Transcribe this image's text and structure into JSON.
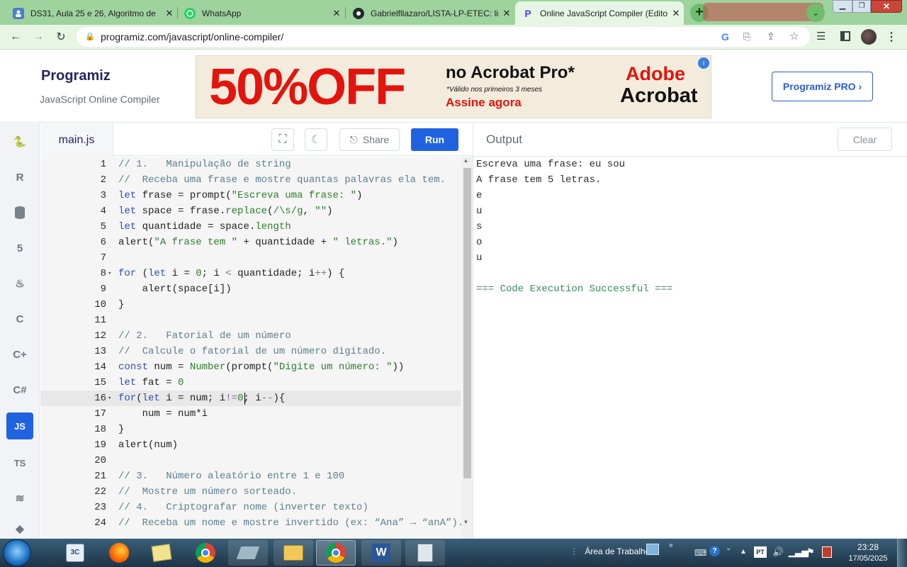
{
  "browser": {
    "tabs": [
      {
        "title": "DS31, Aula 25 e 26, Algoritmo de",
        "icon": "google-classroom-icon",
        "color": "#4a7dd6"
      },
      {
        "title": "WhatsApp",
        "icon": "whatsapp-icon",
        "color": "#25d366"
      },
      {
        "title": "Gabrielfllazaro/LISTA-LP-ETEC: lis",
        "icon": "github-icon",
        "color": "#24292e"
      },
      {
        "title": "Online JavaScript Compiler (Edito",
        "icon": "programiz-icon",
        "color": "#5a3ff4"
      }
    ],
    "new_tab_symbol": "+",
    "url": "programiz.com/javascript/online-compiler/"
  },
  "header": {
    "logo": "Programiz",
    "subtitle": "JavaScript Online Compiler",
    "ad": {
      "big": "50%OFF",
      "line1": "no Acrobat Pro*",
      "line2": "*Válido nos primeiros 3 meses",
      "cta": "Assine agora",
      "brand1": "Adobe",
      "brand2": "Acrobat"
    },
    "pro_button": "Programiz PRO ›"
  },
  "editor": {
    "filename": "main.js",
    "share_label": "Share",
    "run_label": "Run",
    "lines": [
      "// 1.   Manipulação de string",
      "//  Receba uma frase e mostre quantas palavras ela tem.",
      "let frase = prompt(\"Escreva uma frase: \")",
      "let space = frase.replace(/\\s/g, \"\")",
      "let quantidade = space.length",
      "alert(\"A frase tem \" + quantidade + \" letras.\")",
      "",
      "for (let i = 0; i < quantidade; i++) {",
      "    alert(space[i])",
      "}",
      "",
      "// 2.   Fatorial de um número",
      "//  Calcule o fatorial de um número digitado.",
      "const num = Number(prompt(\"Digite um número: \"))",
      "let fat = 0",
      "for(let i = num; i!=0; i--){",
      "    num = num*i",
      "}",
      "alert(num)",
      "",
      "// 3.   Número aleatório entre 1 e 100",
      "//  Mostre um número sorteado.",
      "// 4.   Criptografar nome (inverter texto)",
      "//  Receba um nome e mostre invertido (ex: “Ana” → “anA”)."
    ]
  },
  "output": {
    "title": "Output",
    "clear_label": "Clear",
    "lines": [
      "Escreva uma frase: eu sou",
      "A frase tem 5 letras.",
      "e",
      "u",
      "s",
      "o",
      "u",
      "",
      "=== Code Execution Successful ==="
    ]
  },
  "sidebar": {
    "languages": [
      "python-icon",
      "r-icon",
      "sql-icon",
      "html5-icon",
      "java-icon",
      "c-icon",
      "cpp-icon",
      "csharp-icon",
      "JS",
      "TS",
      "swift-icon",
      "go-icon"
    ],
    "js_label": "JS",
    "ts_label": "TS"
  },
  "taskbar": {
    "desktop_label": "Área de Trabalho",
    "lang": "PT",
    "time": "23:28",
    "date": "17/05/2025"
  }
}
